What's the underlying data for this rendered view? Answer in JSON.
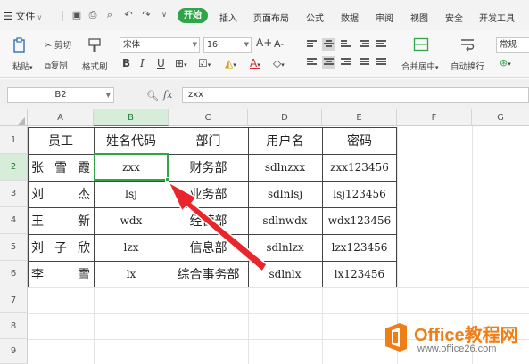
{
  "menubar": {
    "file_label": "文件",
    "tabs": [
      "开始",
      "插入",
      "页面布局",
      "公式",
      "数据",
      "审阅",
      "视图",
      "安全",
      "开发工具"
    ],
    "active_tab": "开始"
  },
  "ribbon": {
    "cut_label": "剪切",
    "copy_label": "复制",
    "format_painter_label": "格式刷",
    "paste_label": "粘贴",
    "font_name": "宋体",
    "font_size": "16",
    "merge_label": "合并居中",
    "wrap_label": "自动换行",
    "number_format": "常规",
    "grow_font": "A+",
    "shrink_font": "A-",
    "bold": "B",
    "italic": "I",
    "underline": "U"
  },
  "formula_bar": {
    "name_box": "B2",
    "fx_label": "fx",
    "formula_value": "zxx"
  },
  "sheet": {
    "columns": [
      "A",
      "B",
      "C",
      "D",
      "E",
      "F",
      "G"
    ],
    "rows": [
      "1",
      "2",
      "3",
      "4",
      "5",
      "6",
      "7",
      "8",
      "9"
    ],
    "selected_cell": "B2",
    "header": [
      "员工",
      "姓名代码",
      "部门",
      "用户名",
      "密码"
    ],
    "data": [
      {
        "employee": [
          "张",
          "雪",
          "霞"
        ],
        "code": "zxx",
        "dept": "财务部",
        "username": "sdlnzxx",
        "password": "zxx123456"
      },
      {
        "employee": [
          "刘",
          "杰"
        ],
        "code": "lsj",
        "dept": "业务部",
        "username": "sdlnlsj",
        "password": "lsj123456"
      },
      {
        "employee": [
          "王",
          "新"
        ],
        "code": "wdx",
        "dept": "经营部",
        "username": "sdlnwdx",
        "password": "wdx123456"
      },
      {
        "employee": [
          "刘",
          "子",
          "欣"
        ],
        "code": "lzx",
        "dept": "信息部",
        "username": "sdlnlzx",
        "password": "lzx123456"
      },
      {
        "employee": [
          "李",
          "雪"
        ],
        "code": "lx",
        "dept": "综合事务部",
        "username": "sdlnlx",
        "password": "lx123456"
      }
    ]
  },
  "watermark": {
    "brand": "Office教程网",
    "url": "www.office26.com",
    "color": "#f07e16"
  },
  "colors": {
    "accent": "#2fa449",
    "annotation_arrow": "#e8262b"
  }
}
